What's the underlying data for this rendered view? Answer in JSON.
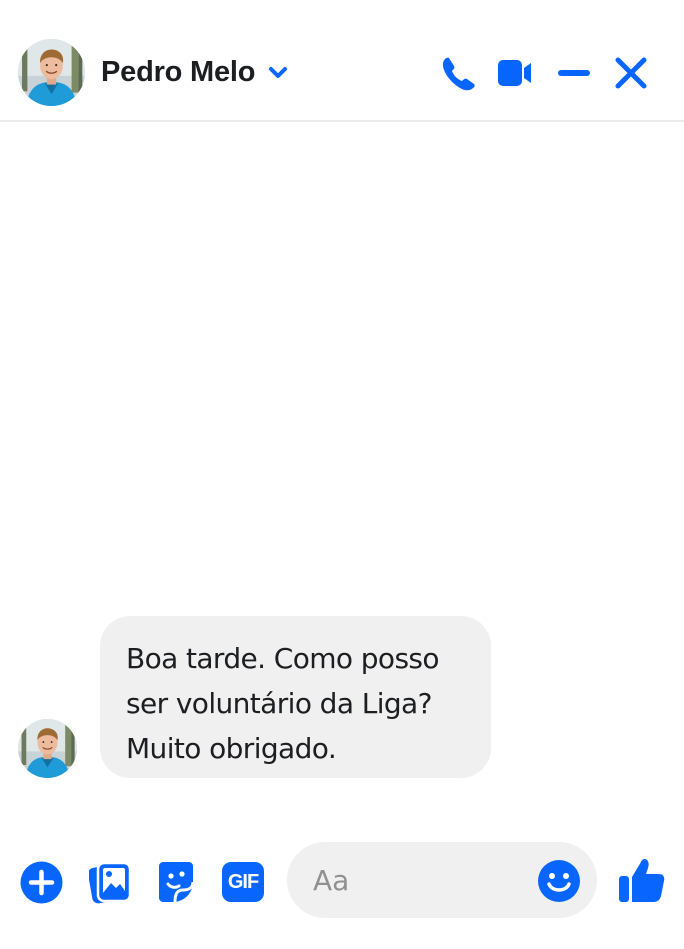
{
  "header": {
    "contact_name": "Pedro Melo",
    "avatar": "profile-photo",
    "actions": [
      "phone-icon",
      "video-camera-icon",
      "minimize-icon",
      "close-icon"
    ]
  },
  "conversation": {
    "messages": [
      {
        "sender": "Pedro Melo",
        "text_lines": [
          "Boa tarde. Como posso",
          "ser voluntário da Liga?",
          "Muito obrigado."
        ]
      }
    ]
  },
  "composer": {
    "placeholder": "Aa",
    "gif_label": "GIF",
    "icons": [
      "plus-circle-icon",
      "photo-gallery-icon",
      "sticker-icon",
      "gif-icon",
      "emoji-icon",
      "thumbs-up-icon"
    ]
  },
  "colors": {
    "accent": "#0866ff",
    "bubble": "#f0f0f0",
    "text": "#1c1e21",
    "placeholder": "#909090"
  }
}
